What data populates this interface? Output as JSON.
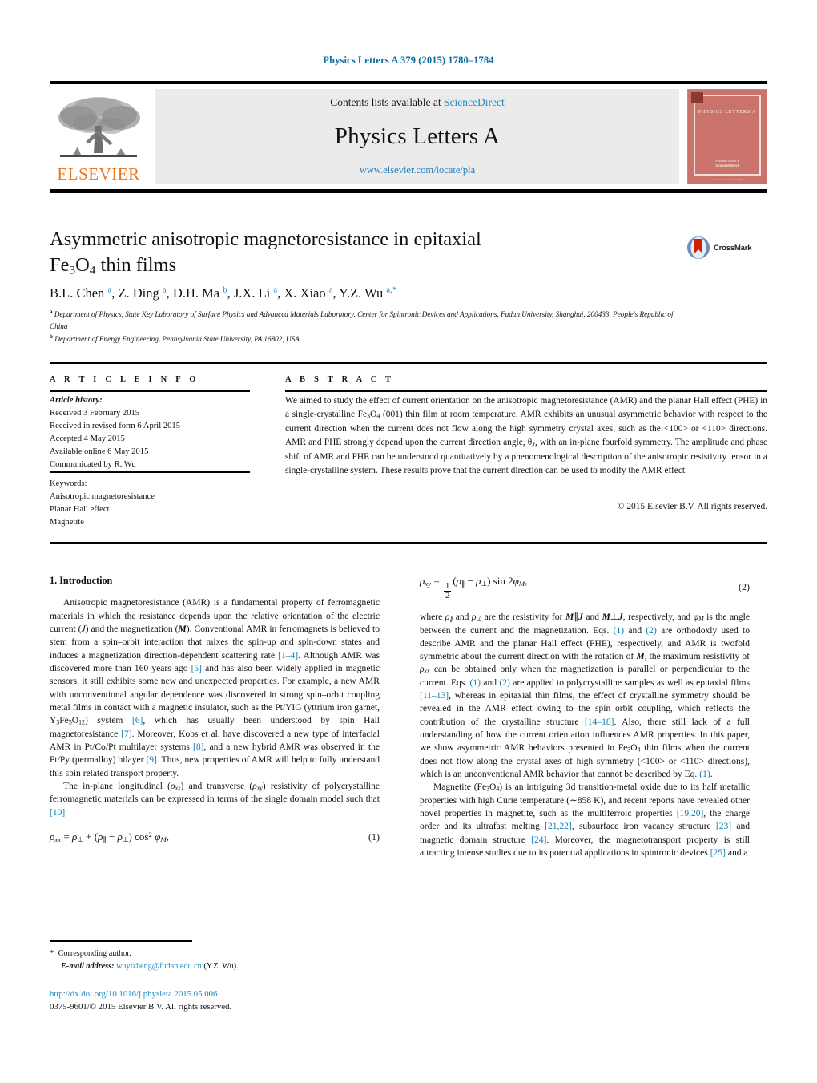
{
  "running_head": "Physics Letters A 379 (2015) 1780–1784",
  "masthead": {
    "publisher_name": "ELSEVIER",
    "contents_prefix": "Contents lists available at ",
    "contents_link": "ScienceDirect",
    "journal_name": "Physics Letters A",
    "journal_url": "www.elsevier.com/locate/pla",
    "cover": {
      "title": "PHYSICS LETTERS A",
      "footer_line1": "Available online at",
      "footer_line2": "ScienceDirect",
      "footer_line3": "www.elsevier.com/locate/pla"
    }
  },
  "article": {
    "title_line1": "Asymmetric anisotropic magnetoresistance in epitaxial",
    "title_line2_pre": "Fe",
    "title_line2_sub1": "3",
    "title_line2_mid": "O",
    "title_line2_sub2": "4",
    "title_line2_post": " thin films",
    "crossmark_label": "CrossMark",
    "authors_html": "B.L. Chen <sup>a</sup>, Z. Ding <sup>a</sup>, D.H. Ma <sup>b</sup>, J.X. Li <sup>a</sup>, X. Xiao <sup>a</sup>, Y.Z. Wu <sup>a,*</sup>",
    "affiliation_a": "Department of Physics, State Key Laboratory of Surface Physics and Advanced Materials Laboratory, Center for Spintronic Devices and Applications, Fudan University, Shanghai, 200433, People's Republic of China",
    "affiliation_b": "Department of Energy Engineering, Pennsylvania State University, PA 16802, USA"
  },
  "info": {
    "heading": "A R T I C L E   I N F O",
    "history_label": "Article history:",
    "history": [
      "Received 3 February 2015",
      "Received in revised form 6 April 2015",
      "Accepted 4 May 2015",
      "Available online 6 May 2015",
      "Communicated by R. Wu"
    ],
    "keywords_label": "Keywords:",
    "keywords": [
      "Anisotropic magnetoresistance",
      "Planar Hall effect",
      "Magnetite"
    ]
  },
  "abstract": {
    "heading": "A B S T R A C T",
    "text_p1": "We aimed to study the effect of current orientation on the anisotropic magnetoresistance (AMR) and the planar Hall effect (PHE) in a single-crystalline Fe",
    "sub1": "3",
    "text_p2": "O",
    "sub2": "4",
    "text_p3": " (001) thin film at room temperature. AMR exhibits an unusual asymmetric behavior with respect to the current direction when the current does not flow along the high symmetry crystal axes, such as the <100> or <110> directions. AMR and PHE strongly depend upon the current direction angle, θ",
    "sub3": "J",
    "text_p4": ", with an in-plane fourfold symmetry. The amplitude and phase shift of AMR and PHE can be understood quantitatively by a phenomenological description of the anisotropic resistivity tensor in a single-crystalline system. These results prove that the current direction can be used to modify the AMR effect.",
    "copyright": "© 2015 Elsevier B.V. All rights reserved."
  },
  "body": {
    "section1_heading": "1. Introduction",
    "left_para1": {
      "t1": "Anisotropic magnetoresistance (AMR) is a fundamental property of ferromagnetic materials in which the resistance depends upon the relative orientation of the electric current (",
      "J": "J",
      "t2": ") and the magnetization (",
      "M": "M",
      "t3": "). Conventional AMR in ferromagnets is believed to stem from a spin–orbit interaction that mixes the spin-up and spin-down states and induces a magnetization direction-dependent scattering rate ",
      "r1": "[1–4]",
      "t4": ". Although AMR was discovered more than 160 years ago ",
      "r2": "[5]",
      "t5": " and has also been widely applied in magnetic sensors, it still exhibits some new and unexpected properties. For example, a new AMR with unconventional angular dependence was discovered in strong spin–orbit coupling metal films in contact with a magnetic insulator, such as the Pt/YIG (yttrium iron garnet, Y",
      "sub_y3": "3",
      "t6": "Fe",
      "sub_fe5": "5",
      "t7": "O",
      "sub_o12": "12",
      "t8": ") system ",
      "r3": "[6]",
      "t9": ", which has usually been understood by spin Hall magnetoresistance ",
      "r4": "[7]",
      "t10": ". Moreover, Kobs et al. have discovered a new type of interfacial AMR in Pt/Co/Pt multilayer systems ",
      "r5": "[8]",
      "t11": ", and a new hybrid AMR was observed in the Pt/Py (permalloy) bilayer ",
      "r6": "[9]",
      "t12": ". Thus, new properties of AMR will help to fully understand this spin related transport property."
    },
    "left_para2": {
      "t1": "The in-plane longitudinal (",
      "rho_xx": "ρxx",
      "t2": ") and transverse (",
      "rho_xy": "ρxy",
      "t3": ") resistivity of polycrystalline ferromagnetic materials can be expressed in terms of the single domain model such that ",
      "r1": "[10]"
    },
    "eq1_number": "(1)",
    "eq2_number": "(2)",
    "right_para1": {
      "t1": "where ",
      "rho_par": "ρ∥",
      "t2": " and ",
      "rho_perp": "ρ⊥",
      "t3": " are the resistivity for ",
      "mj1": "M∥J",
      "t4": " and ",
      "mj2": "M⊥J",
      "t5": ", respectively, and ",
      "phiM": "φM",
      "t6": " is the angle between the current and the magnetization. Eqs. ",
      "r1": "(1)",
      "t7": " and ",
      "r2": "(2)",
      "t8": " are orthodoxly used to describe AMR and the planar Hall effect (PHE), respectively, and AMR is twofold symmetric about the current direction with the rotation of ",
      "M": "M",
      "t9": ", the maximum resistivity of ",
      "rho_xx": "ρxx",
      "t10": " can be obtained only when the magnetization is parallel or perpendicular to the current. Eqs. ",
      "r3": "(1)",
      "t11": " and ",
      "r4": "(2)",
      "t12": " are applied to polycrystalline samples as well as epitaxial films ",
      "r5": "[11–13]",
      "t13": ", whereas in epitaxial thin films, the effect of crystalline symmetry should be revealed in the AMR effect owing to the spin–orbit coupling, which reflects the contribution of the crystalline structure ",
      "r6": "[14–18]",
      "t14": ". Also, there still lack of a full understanding of how the current orientation influences AMR properties. In this paper, we show asymmetric AMR behaviors presented in Fe",
      "sub3": "3",
      "t15": "O",
      "sub4": "4",
      "t16": " thin films when the current does not flow along the crystal axes of high symmetry (<100> or <110> directions), which is an unconventional AMR behavior that cannot be described by Eq. ",
      "r7": "(1)",
      "t17": "."
    },
    "right_para2": {
      "t1": "Magnetite (Fe",
      "sub3": "3",
      "t2": "O",
      "sub4": "4",
      "t3": ") is an intriguing 3d transition-metal oxide due to its half metallic properties with high Curie temperature (∼858 K), and recent reports have revealed other novel properties in magnetite, such as the multiferroic properties ",
      "r1": "[19,20]",
      "t4": ", the charge order and its ultrafast melting ",
      "r2": "[21,22]",
      "t5": ", subsurface iron vacancy structure ",
      "r3": "[23]",
      "t6": " and magnetic domain structure ",
      "r4": "[24]",
      "t7": ". Moreover, the magnetotransport property is still attracting intense studies due to its potential applications in spintronic devices ",
      "r5": "[25]",
      "t8": " and a"
    }
  },
  "footer": {
    "corresponding_star": "*",
    "corresponding_label": "Corresponding author.",
    "email_label": "E-mail address:",
    "email": "wuyizheng@fudan.edu.cn",
    "email_suffix": " (Y.Z. Wu).",
    "doi": "http://dx.doi.org/10.1016/j.physleta.2015.05.006",
    "issn_line": "0375-9601/© 2015 Elsevier B.V. All rights reserved."
  },
  "colors": {
    "link": "#1f8ac0",
    "reference": "#0f7fb5",
    "elsevier_orange": "#E87722",
    "cover_red": "#c9736a"
  }
}
